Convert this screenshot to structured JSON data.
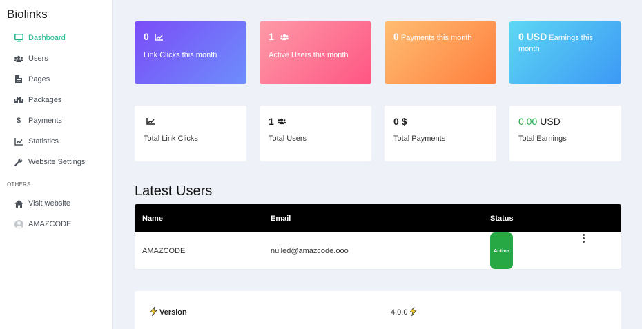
{
  "brand": "Biolinks",
  "sidebar": {
    "items": [
      {
        "label": "Dashboard",
        "icon": "monitor-icon",
        "active": true
      },
      {
        "label": "Users",
        "icon": "users-icon"
      },
      {
        "label": "Pages",
        "icon": "file-icon"
      },
      {
        "label": "Packages",
        "icon": "boxes-icon"
      },
      {
        "label": "Payments",
        "icon": "dollar-icon"
      },
      {
        "label": "Statistics",
        "icon": "chart-line-icon"
      },
      {
        "label": "Website Settings",
        "icon": "wrench-icon"
      }
    ],
    "section_label": "OTHERS",
    "other_items": [
      {
        "label": "Visit website",
        "icon": "home-icon"
      },
      {
        "label": "AMAZCODE",
        "icon": "avatar-icon"
      }
    ]
  },
  "month_cards": [
    {
      "value": "0",
      "label": "Link Clicks this month",
      "icon": "chart-line-icon"
    },
    {
      "value": "1",
      "label": "Active Users this month",
      "icon": "users-icon"
    },
    {
      "value": "0",
      "label": "Payments this month"
    },
    {
      "value": "0 USD",
      "label": "Earnings this month"
    }
  ],
  "total_cards": [
    {
      "value": "",
      "label": "Total Link Clicks",
      "icon": "chart-line-icon"
    },
    {
      "value": "1",
      "label": "Total Users",
      "icon": "users-icon"
    },
    {
      "value": "0 $",
      "label": "Total Payments"
    },
    {
      "value": "0.00",
      "unit": "USD",
      "label": "Total Earnings"
    }
  ],
  "latest_users": {
    "title": "Latest Users",
    "columns": [
      "Name",
      "Email",
      "Status",
      ""
    ],
    "rows": [
      {
        "name": "AMAZCODE",
        "email": "nulled@amazcode.ooo",
        "status": "Active"
      }
    ]
  },
  "version": {
    "label": "Version",
    "value": "4.0.0"
  },
  "colors": {
    "accent": "#1fb78d",
    "active_badge": "#28a745",
    "table_header": "#000000"
  }
}
